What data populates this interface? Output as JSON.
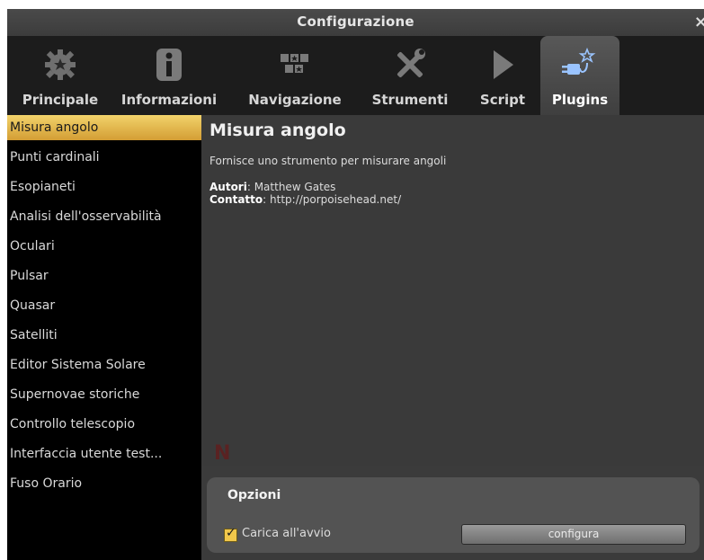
{
  "window": {
    "title": "Configurazione",
    "close_glyph": "×"
  },
  "toolbar": {
    "tabs": [
      {
        "label": "Principale",
        "icon": "gear-icon"
      },
      {
        "label": "Informazioni",
        "icon": "info-icon"
      },
      {
        "label": "Navigazione",
        "icon": "navigation-icon"
      },
      {
        "label": "Strumenti",
        "icon": "tools-icon"
      },
      {
        "label": "Script",
        "icon": "play-icon"
      },
      {
        "label": "Plugins",
        "icon": "plugin-icon"
      }
    ],
    "active_tab": "Plugins"
  },
  "sidebar": {
    "items": [
      {
        "label": "Misura angolo"
      },
      {
        "label": "Punti cardinali"
      },
      {
        "label": "Esopianeti"
      },
      {
        "label": "Analisi dell'osservabilità"
      },
      {
        "label": "Oculari"
      },
      {
        "label": "Pulsar"
      },
      {
        "label": "Quasar"
      },
      {
        "label": "Satelliti"
      },
      {
        "label": "Editor Sistema Solare"
      },
      {
        "label": "Supernovae storiche"
      },
      {
        "label": "Controllo telescopio"
      },
      {
        "label": "Interfaccia utente test..."
      },
      {
        "label": "Fuso Orario"
      }
    ],
    "selected": "Misura angolo"
  },
  "plugin": {
    "title": "Misura angolo",
    "description": "Fornisce uno strumento per misurare angoli",
    "authors_label": "Autori",
    "authors_value": ": Matthew Gates",
    "contact_label": "Contatto",
    "contact_value": ": http://porpoisehead.net/",
    "faded_letter": "N"
  },
  "options": {
    "title": "Opzioni",
    "load_at_startup_label": "Carica all'avvio",
    "load_at_startup_checked": true,
    "configure_button": "configura"
  },
  "colors": {
    "accent": "#e8b94a",
    "window_bg": "#3b3b3b",
    "sidebar_bg": "#000000"
  }
}
